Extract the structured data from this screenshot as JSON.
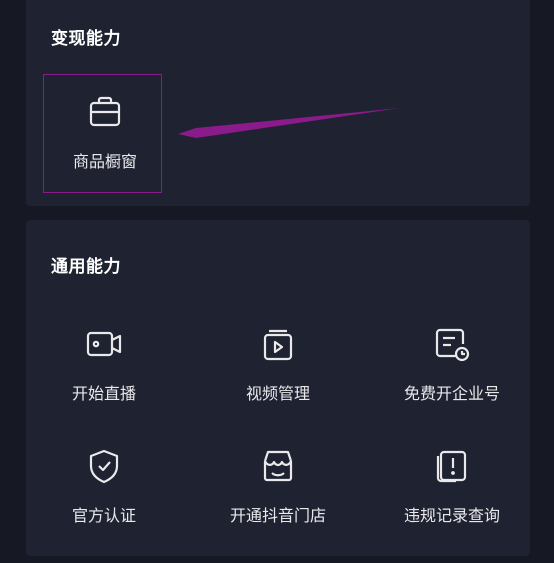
{
  "monetize": {
    "title": "变现能力",
    "items": [
      {
        "label": "商品橱窗",
        "icon": "shop-window-icon"
      }
    ]
  },
  "general": {
    "title": "通用能力",
    "items": [
      {
        "label": "开始直播",
        "icon": "video-camera-icon"
      },
      {
        "label": "视频管理",
        "icon": "video-manage-icon"
      },
      {
        "label": "免费开企业号",
        "icon": "enterprise-account-icon"
      },
      {
        "label": "官方认证",
        "icon": "shield-check-icon"
      },
      {
        "label": "开通抖音门店",
        "icon": "store-icon"
      },
      {
        "label": "违规记录查询",
        "icon": "violation-record-icon"
      }
    ]
  },
  "colors": {
    "background": "#161823",
    "card": "#1f2230",
    "text": "#e9e9ec",
    "annotation": "#8b1a8b"
  }
}
